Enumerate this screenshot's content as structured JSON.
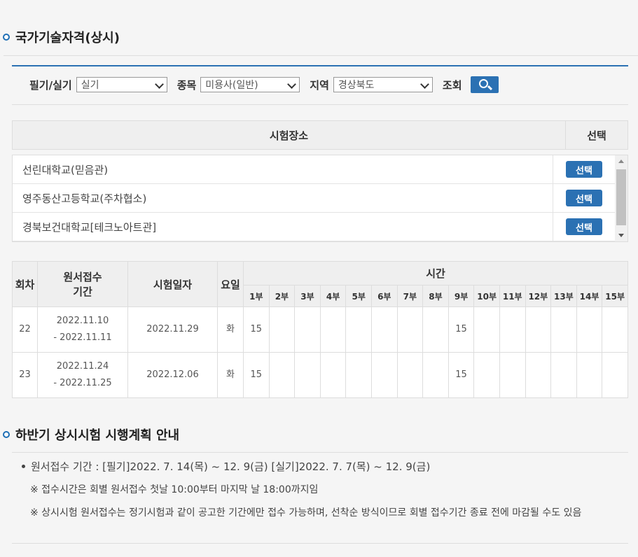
{
  "page_title": "국가기술자격(상시)",
  "search": {
    "type_label": "필기/실기",
    "type_value": "실기",
    "category_label": "종목",
    "category_value": "미용사(일반)",
    "region_label": "지역",
    "region_value": "경상북도",
    "search_label": "조회"
  },
  "venue_table": {
    "headers": {
      "place": "시험장소",
      "select": "선택"
    },
    "rows": [
      {
        "name": "선린대학교(믿음관)",
        "button": "선택"
      },
      {
        "name": "영주동산고등학교(주차협소)",
        "button": "선택"
      },
      {
        "name": "경북보건대학교[테크노아트관]",
        "button": "선택"
      }
    ]
  },
  "schedule_table": {
    "headers": {
      "round": "회차",
      "period": "원서접수 기간",
      "period_line1": "원서접수",
      "period_line2": "기간",
      "date": "시험일자",
      "day": "요일",
      "time": "시간",
      "parts": [
        "1부",
        "2부",
        "3부",
        "4부",
        "5부",
        "6부",
        "7부",
        "8부",
        "9부",
        "10부",
        "11부",
        "12부",
        "13부",
        "14부",
        "15부"
      ]
    },
    "rows": [
      {
        "round": "22",
        "period_start": "2022.11.10",
        "period_end": "- 2022.11.11",
        "date": "2022.11.29",
        "day": "화",
        "parts": [
          "15",
          "",
          "",
          "",
          "",
          "",
          "",
          "",
          "15",
          "",
          "",
          "",
          "",
          "",
          ""
        ]
      },
      {
        "round": "23",
        "period_start": "2022.11.24",
        "period_end": "- 2022.11.25",
        "date": "2022.12.06",
        "day": "화",
        "parts": [
          "15",
          "",
          "",
          "",
          "",
          "",
          "",
          "",
          "15",
          "",
          "",
          "",
          "",
          "",
          ""
        ]
      }
    ]
  },
  "notice": {
    "title": "하반기 상시시험 시행계획 안내",
    "line1": "원서접수 기간 : [필기]2022. 7. 14(목) ~ 12. 9(금) [실기]2022. 7. 7(목) ~ 12. 9(금)",
    "note1": "※ 접수시간은 회별 원서접수 첫날 10:00부터 마지막 날 18:00까지임",
    "note2": "※ 상시시험 원서접수는 정기시험과 같이 공고한 기간에만 접수 가능하며, 선착순 방식이므로 회별 접수기간 종료 전에 마감될 수도 있음"
  },
  "colors": {
    "accent": "#2b71b3",
    "border": "#dddddd",
    "header_bg": "#efefef"
  }
}
